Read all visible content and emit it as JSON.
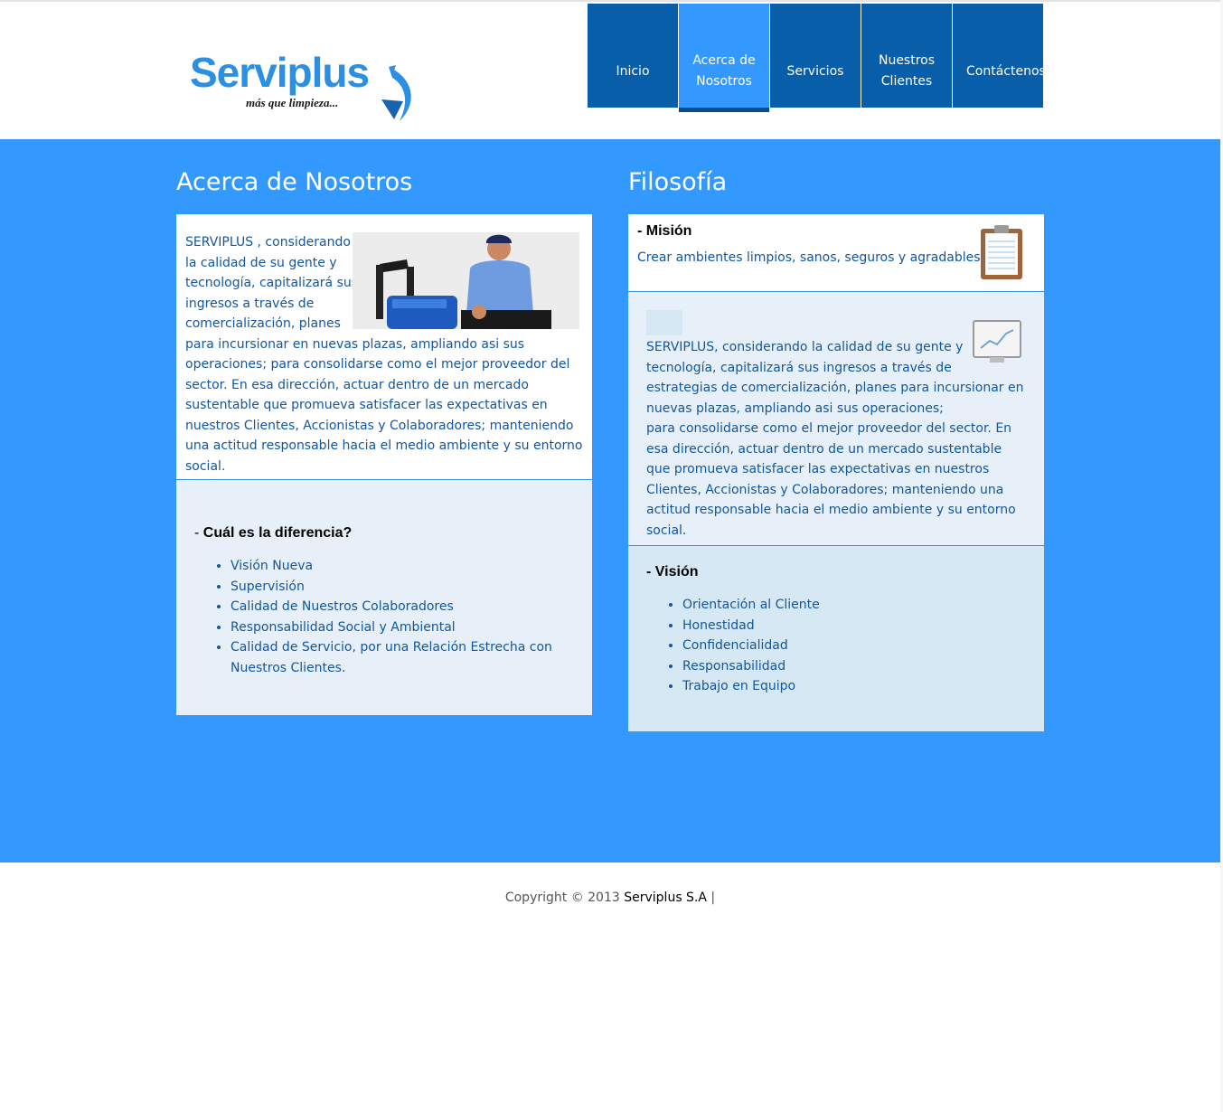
{
  "logo": {
    "name": "Serviplus",
    "tagline": "más que limpieza..."
  },
  "nav": [
    {
      "label": "Inicio",
      "active": false
    },
    {
      "label": "Acerca de Nosotros",
      "active": true
    },
    {
      "label": "Servicios",
      "active": false
    },
    {
      "label": "Nuestros Clientes",
      "active": false
    },
    {
      "label": "Contáctenos",
      "active": false
    }
  ],
  "about": {
    "title": "Acerca de Nosotros",
    "intro_lines": [
      "SERVIPLUS , considerando",
      "la calidad de su gente y",
      "tecnología, capitalizará sus",
      "ingresos a través de",
      "comercialización, planes"
    ],
    "intro_rest": "para incursionar en nuevas plazas, ampliando asi sus operaciones; para consolidarse como el mejor proveedor del sector. En esa dirección, actuar dentro de un mercado sustentable que promueva satisfacer las expectativas en nuestros Clientes, Accionistas y Colaboradores; manteniendo una actitud responsable hacia el medio ambiente y su entorno social.",
    "difference_dash": "- ",
    "difference_title": "Cuál es la diferencia?",
    "difference_items": [
      "Visión Nueva",
      "Supervisión",
      "Calidad de Nuestros Colaboradores",
      "Responsabilidad Social y Ambiental",
      "Calidad de Servicio, por una Relación Estrecha con Nuestros Clientes."
    ]
  },
  "philosophy": {
    "title": "Filosofía",
    "mision_title": "- Misión",
    "mision_text": "Crear ambientes limpios, sanos, seguros y agradables.",
    "middle_text_1": "SERVIPLUS, considerando la calidad de su gente y tecnología, capitalizará sus ingresos a través de estrategias de comercialización, planes para incursionar en nuevas plazas, ampliando asi sus operaciones;",
    "middle_text_2": "para consolidarse como el mejor proveedor del sector. En esa dirección, actuar dentro de un mercado sustentable que promueva satisfacer las expectativas en nuestros Clientes, Accionistas y Colaboradores; manteniendo una actitud responsable hacia el medio ambiente y su entorno social.",
    "vision_title": "- Visión",
    "vision_items": [
      "Orientación al Cliente",
      "Honestidad",
      "Confidencialidad",
      "Responsabilidad",
      "Trabajo en Equipo"
    ]
  },
  "footer": {
    "copyright": "Copyright © 2013 ",
    "brand": "Serviplus S.A",
    "separator": " |"
  },
  "colors": {
    "band": "#3399ff",
    "nav": "#085ea8",
    "nav_active": "#3399ff",
    "text_blue": "#11569e"
  }
}
